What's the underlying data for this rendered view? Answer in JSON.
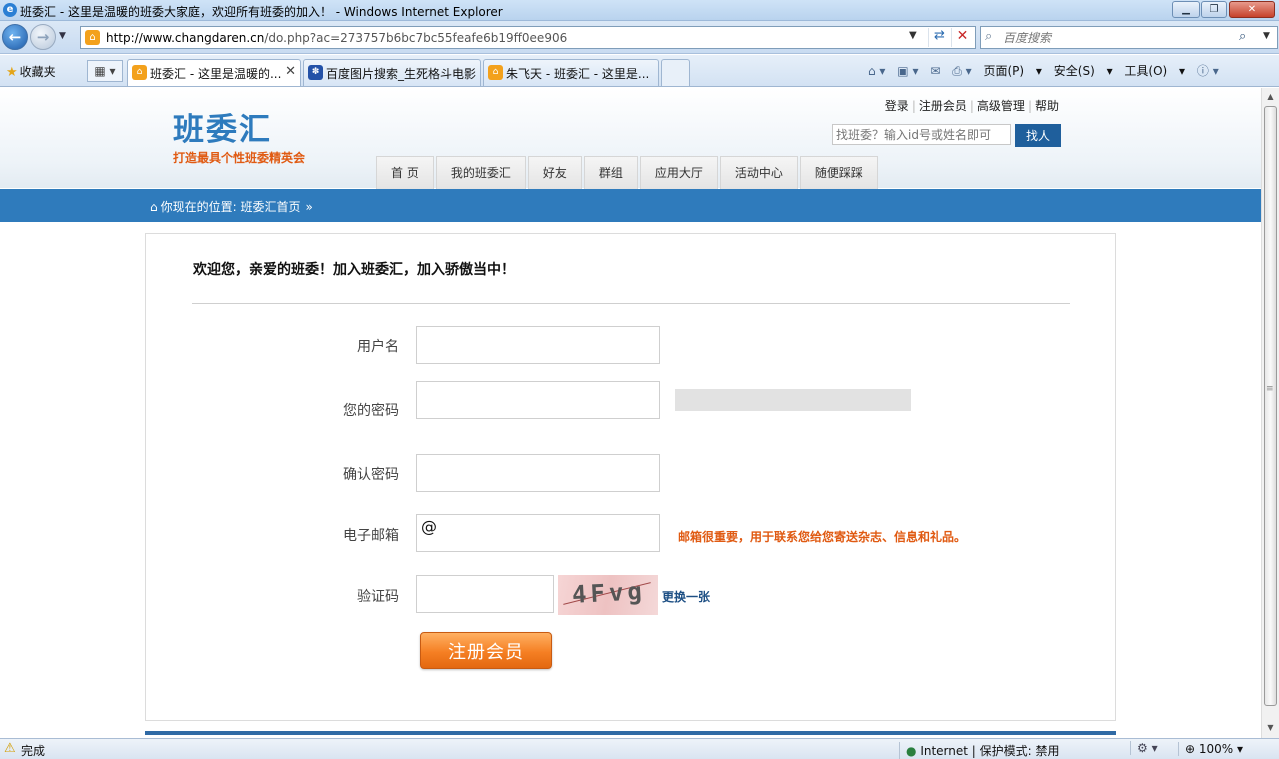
{
  "window": {
    "title": "班委汇 - 这里是温暖的班委大家庭，欢迎所有班委的加入！ - Windows Internet Explorer"
  },
  "address": {
    "url_host": "http://www.changdaren.cn",
    "url_path": "/do.php?ac=273757b6bc7bc55feafe6b19ff0ee906",
    "search_placeholder": "百度搜索"
  },
  "tabs": {
    "favorites_label": "收藏夹",
    "items": [
      {
        "label": "班委汇 - 这里是温暖的...",
        "active": true
      },
      {
        "label": "百度图片搜索_生死格斗电影",
        "active": false
      },
      {
        "label": "朱飞天 - 班委汇 - 这里是...",
        "active": false
      }
    ]
  },
  "command_bar": {
    "page": "页面(P)",
    "safety": "安全(S)",
    "tools": "工具(O)"
  },
  "site": {
    "logo_name": "班委汇",
    "slogan": "打造最具个性班委精英会",
    "top_links": [
      "登录",
      "注册会员",
      "高级管理",
      "帮助"
    ],
    "search_placeholder": "找班委？输入id号或姓名即可",
    "search_button": "找人",
    "nav": [
      "首 页",
      "我的班委汇",
      "好友",
      "群组",
      "应用大厅",
      "活动中心",
      "随便踩踩"
    ],
    "breadcrumb_prefix": "你现在的位置:",
    "breadcrumb_current": "班委汇首页",
    "breadcrumb_arrow": "»"
  },
  "form": {
    "welcome": "欢迎您，亲爱的班委！加入班委汇，加入骄傲当中！",
    "username_label": "用户名",
    "password_label": "您的密码",
    "confirm_label": "确认密码",
    "email_label": "电子邮箱",
    "email_value": "@",
    "email_tip": "邮箱很重要，用于联系您给您寄送杂志、信息和礼品。",
    "captcha_label": "验证码",
    "captcha_code": "4Fvg",
    "captcha_refresh": "更换一张",
    "submit": "注册会员"
  },
  "status": {
    "done": "完成",
    "zone": "Internet | 保护模式: 禁用",
    "zoom": "100%"
  },
  "colors": {
    "brand_blue": "#2f7bbc",
    "accent_orange": "#e05a12",
    "button_orange": "#f57f23"
  }
}
